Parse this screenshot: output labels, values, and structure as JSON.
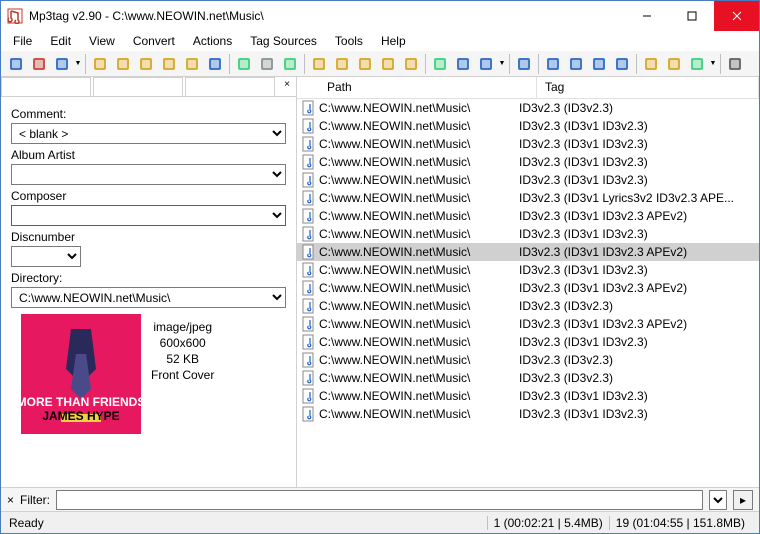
{
  "title": "Mp3tag v2.90  -  C:\\www.NEOWIN.net\\Music\\",
  "menu": [
    "File",
    "Edit",
    "View",
    "Convert",
    "Actions",
    "Tag Sources",
    "Tools",
    "Help"
  ],
  "fields": {
    "comment_label": "Comment:",
    "comment_value": "< blank >",
    "albumartist_label": "Album Artist",
    "albumartist_value": "",
    "composer_label": "Composer",
    "composer_value": "",
    "discnumber_label": "Discnumber",
    "discnumber_value": "",
    "directory_label": "Directory:",
    "directory_value": "C:\\www.NEOWIN.net\\Music\\"
  },
  "cover": {
    "mime": "image/jpeg",
    "dims": "600x600",
    "size": "52 KB",
    "type": "Front Cover",
    "text1": "MORE THAN FRIENDS",
    "text2": "JAMES HYPE"
  },
  "columns": {
    "path": "Path",
    "tag": "Tag"
  },
  "rows": [
    {
      "path": "C:\\www.NEOWIN.net\\Music\\",
      "tag": "ID3v2.3 (ID3v2.3)",
      "sel": false
    },
    {
      "path": "C:\\www.NEOWIN.net\\Music\\",
      "tag": "ID3v2.3 (ID3v1 ID3v2.3)",
      "sel": false
    },
    {
      "path": "C:\\www.NEOWIN.net\\Music\\",
      "tag": "ID3v2.3 (ID3v1 ID3v2.3)",
      "sel": false
    },
    {
      "path": "C:\\www.NEOWIN.net\\Music\\",
      "tag": "ID3v2.3 (ID3v1 ID3v2.3)",
      "sel": false
    },
    {
      "path": "C:\\www.NEOWIN.net\\Music\\",
      "tag": "ID3v2.3 (ID3v1 ID3v2.3)",
      "sel": false
    },
    {
      "path": "C:\\www.NEOWIN.net\\Music\\",
      "tag": "ID3v2.3 (ID3v1 Lyrics3v2 ID3v2.3 APE...",
      "sel": false
    },
    {
      "path": "C:\\www.NEOWIN.net\\Music\\",
      "tag": "ID3v2.3 (ID3v1 ID3v2.3 APEv2)",
      "sel": false
    },
    {
      "path": "C:\\www.NEOWIN.net\\Music\\",
      "tag": "ID3v2.3 (ID3v1 ID3v2.3)",
      "sel": false
    },
    {
      "path": "C:\\www.NEOWIN.net\\Music\\",
      "tag": "ID3v2.3 (ID3v1 ID3v2.3 APEv2)",
      "sel": true
    },
    {
      "path": "C:\\www.NEOWIN.net\\Music\\",
      "tag": "ID3v2.3 (ID3v1 ID3v2.3)",
      "sel": false
    },
    {
      "path": "C:\\www.NEOWIN.net\\Music\\",
      "tag": "ID3v2.3 (ID3v1 ID3v2.3 APEv2)",
      "sel": false
    },
    {
      "path": "C:\\www.NEOWIN.net\\Music\\",
      "tag": "ID3v2.3 (ID3v2.3)",
      "sel": false
    },
    {
      "path": "C:\\www.NEOWIN.net\\Music\\",
      "tag": "ID3v2.3 (ID3v1 ID3v2.3 APEv2)",
      "sel": false
    },
    {
      "path": "C:\\www.NEOWIN.net\\Music\\",
      "tag": "ID3v2.3 (ID3v1 ID3v2.3)",
      "sel": false
    },
    {
      "path": "C:\\www.NEOWIN.net\\Music\\",
      "tag": "ID3v2.3 (ID3v2.3)",
      "sel": false
    },
    {
      "path": "C:\\www.NEOWIN.net\\Music\\",
      "tag": "ID3v2.3 (ID3v2.3)",
      "sel": false
    },
    {
      "path": "C:\\www.NEOWIN.net\\Music\\",
      "tag": "ID3v2.3 (ID3v1 ID3v2.3)",
      "sel": false
    },
    {
      "path": "C:\\www.NEOWIN.net\\Music\\",
      "tag": "ID3v2.3 (ID3v1 ID3v2.3)",
      "sel": false
    }
  ],
  "filter": {
    "label": "Filter:",
    "value": ""
  },
  "status": {
    "ready": "Ready",
    "sel": "1 (00:02:21 | 5.4MB)",
    "total": "19 (01:04:55 | 151.8MB)"
  },
  "toolbar_icons": [
    {
      "n": "save-icon",
      "c": "#1e5fbf"
    },
    {
      "n": "delete-icon",
      "c": "#c0392b"
    },
    {
      "n": "undo-icon",
      "c": "#1e5fbf",
      "dd": true
    },
    {
      "sep": true
    },
    {
      "n": "folder-open-icon",
      "c": "#d4a017"
    },
    {
      "n": "folder-add-icon",
      "c": "#d4a017"
    },
    {
      "n": "folder-sub-icon",
      "c": "#d4a017"
    },
    {
      "n": "folder-fav-icon",
      "c": "#d4a017"
    },
    {
      "n": "star-icon",
      "c": "#d4a017"
    },
    {
      "n": "refresh-icon",
      "c": "#1e5fbf"
    },
    {
      "sep": true
    },
    {
      "n": "playlist-icon",
      "c": "#2ecc71"
    },
    {
      "n": "select-all-icon",
      "c": "#7f8c8d"
    },
    {
      "n": "export-icon",
      "c": "#2ecc71"
    },
    {
      "sep": true
    },
    {
      "n": "tag-to-file-icon",
      "c": "#d4a017"
    },
    {
      "n": "file-to-tag-icon",
      "c": "#d4a017"
    },
    {
      "n": "tag-to-tag-icon",
      "c": "#d4a017"
    },
    {
      "n": "text-to-tag-icon",
      "c": "#d4a017"
    },
    {
      "n": "tag-to-text-icon",
      "c": "#d4a017"
    },
    {
      "sep": true
    },
    {
      "n": "actions-icon",
      "c": "#2ecc71"
    },
    {
      "n": "autonum-icon",
      "c": "#1e5fbf"
    },
    {
      "n": "case-icon",
      "c": "#1e5fbf",
      "dd": true
    },
    {
      "sep": true
    },
    {
      "n": "edit-icon",
      "c": "#1e5fbf"
    },
    {
      "sep": true
    },
    {
      "n": "d1-icon",
      "c": "#1e5fbf"
    },
    {
      "n": "d2-icon",
      "c": "#1e5fbf"
    },
    {
      "n": "d3-icon",
      "c": "#1e5fbf"
    },
    {
      "n": "d4-icon",
      "c": "#1e5fbf"
    },
    {
      "sep": true
    },
    {
      "n": "g1-icon",
      "c": "#d4a017"
    },
    {
      "n": "g2-icon",
      "c": "#d4a017"
    },
    {
      "n": "g3-icon",
      "c": "#2ecc71",
      "dd": true
    },
    {
      "sep": true
    },
    {
      "n": "settings-icon",
      "c": "#555"
    }
  ]
}
